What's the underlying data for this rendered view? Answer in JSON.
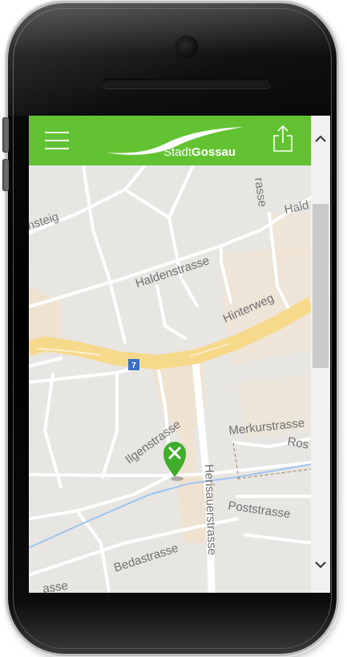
{
  "header": {
    "logo_text_regular": "Stadt",
    "logo_text_bold": "Gossau",
    "menu_icon": "hamburger-icon",
    "share_icon": "share-icon"
  },
  "map": {
    "streets": {
      "steig": "nsteig",
      "hald_top": "Hald",
      "strasse_top": "rasse",
      "haldenstrasse": "Haldenstrasse",
      "hinterweg": "Hinterweg",
      "route_number": "7",
      "ilgenstrasse": "Ilgenstrasse",
      "merkurstrasse": "Merkurstrasse",
      "ros": "Ros",
      "herisauerstrasse": "Herisauerstrasse",
      "poststrasse": "Poststrasse",
      "bedastrasse": "Bedastrasse",
      "asse_bottom": "asse"
    },
    "marker_icon": "map-pin-restaurant-icon"
  },
  "colors": {
    "header": "#62c232",
    "main_road": "#f6d98a",
    "area": "#f0e2cf",
    "river": "#9ec4f2"
  }
}
